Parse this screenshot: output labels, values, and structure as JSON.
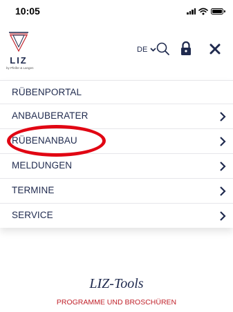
{
  "status_bar": {
    "time": "10:05"
  },
  "header": {
    "logo_text": "LIZ",
    "logo_subtitle": "by Pfeifer & Langen",
    "language": "DE",
    "icons": [
      "chevron-down-icon",
      "search-icon",
      "lock-icon",
      "close-icon"
    ]
  },
  "menu": {
    "items": [
      {
        "label": "RÜBENPORTAL",
        "has_chevron": false
      },
      {
        "label": "ANBAUBERATER",
        "has_chevron": true
      },
      {
        "label": "RÜBENANBAU",
        "has_chevron": true,
        "highlighted": true
      },
      {
        "label": "MELDUNGEN",
        "has_chevron": true
      },
      {
        "label": "TERMINE",
        "has_chevron": true
      },
      {
        "label": "SERVICE",
        "has_chevron": true
      }
    ]
  },
  "page": {
    "section_title": "LIZ-Tools",
    "section_subtitle": "PROGRAMME UND BROSCHÜREN"
  },
  "colors": {
    "brand_navy": "#1f2a4e",
    "highlight_red": "#e10613",
    "subtitle_red": "#c0212a"
  }
}
